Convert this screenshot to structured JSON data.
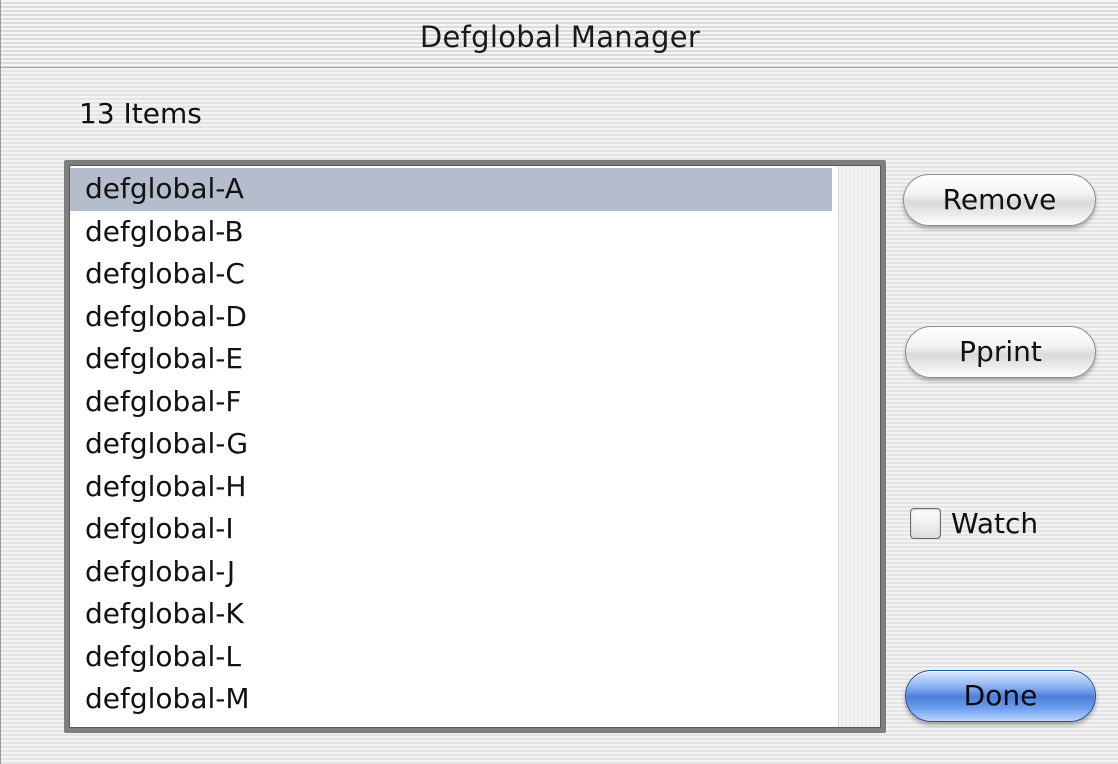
{
  "window": {
    "title": "Defglobal Manager"
  },
  "item_count": "13 Items",
  "list": {
    "selected_index": 0,
    "items": [
      "defglobal-A",
      "defglobal-B",
      "defglobal-C",
      "defglobal-D",
      "defglobal-E",
      "defglobal-F",
      "defglobal-G",
      "defglobal-H",
      "defglobal-I",
      "defglobal-J",
      "defglobal-K",
      "defglobal-L",
      "defglobal-M"
    ]
  },
  "buttons": {
    "remove_label": "Remove",
    "pprint_label": "Pprint",
    "done_label": "Done"
  },
  "watch": {
    "label": "Watch",
    "checked": false
  },
  "colors": {
    "selection": "#b5bccc",
    "default_button": "#4d7fd9"
  }
}
